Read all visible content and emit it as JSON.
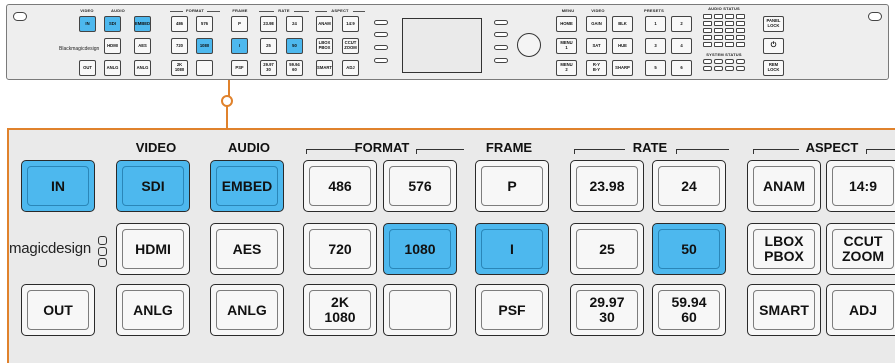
{
  "colors": {
    "accent_orange": "#e0822c",
    "active_blue": "#4db8ee",
    "panel_bg": "#eaeaea"
  },
  "overview": {
    "headers": {
      "video": "VIDEO",
      "audio": "AUDIO",
      "format": "FORMAT",
      "frame": "FRAME",
      "rate": "RATE",
      "aspect": "ASPECT",
      "menu": "MENU",
      "video2": "VIDEO",
      "presets": "PRESETS",
      "audio_status": "AUDIO STATUS",
      "system_status": "SYSTEM STATUS"
    },
    "logo": "Blackmagicdesign",
    "keys": {
      "in": "IN",
      "sdi": "SDI",
      "embed": "EMBED",
      "hdmi": "HDMI",
      "aes": "AES",
      "out": "OUT",
      "anlg_v": "ANLG",
      "anlg_a": "ANLG",
      "f486": "486",
      "f576": "576",
      "f720": "720",
      "f1080": "1080",
      "f2k": "2K\n1080",
      "fblank": "",
      "p": "P",
      "i": "I",
      "psf": "PSF",
      "r2398": "23.98",
      "r24": "24",
      "r25": "25",
      "r50": "50",
      "r2997": "29.97\n30",
      "r5994": "59.94\n60",
      "anam": "ANAM",
      "a149": "14:9",
      "lbox": "LBOX\nPBOX",
      "ccut": "CCUT\nZOOM",
      "smart": "SMART",
      "adj": "ADJ",
      "home": "HOME",
      "menu1": "MENU\n1",
      "menu2": "MENU\n2",
      "gain": "GAIN",
      "blk": "BLK",
      "sat": "SAT",
      "hue": "HUE",
      "ry": "R-Y\nB-Y",
      "sharp": "SHARP",
      "p1": "1",
      "p2": "2",
      "p3": "3",
      "p4": "4",
      "p5": "5",
      "p6": "6",
      "panel_lock": "PANEL\nLOCK",
      "power": "⏻",
      "rem_lock": "REM\nLOCK"
    }
  },
  "zoom": {
    "headers": {
      "video": "VIDEO",
      "audio": "AUDIO",
      "format": "FORMAT",
      "frame": "FRAME",
      "rate": "RATE",
      "aspect": "ASPECT"
    },
    "logo": "magicdesign",
    "buttons": {
      "in": "IN",
      "sdi": "SDI",
      "embed": "EMBED",
      "f486": "486",
      "f576": "576",
      "p": "P",
      "r2398": "23.98",
      "r24": "24",
      "anam": "ANAM",
      "a149": "14:9",
      "hdmi": "HDMI",
      "aes": "AES",
      "f720": "720",
      "f1080": "1080",
      "i": "I",
      "r25": "25",
      "r50": "50",
      "lbox": "LBOX\nPBOX",
      "ccut": "CCUT\nZOOM",
      "out": "OUT",
      "anlg_v": "ANLG",
      "anlg_a": "ANLG",
      "f2k": "2K\n1080",
      "fblank": "",
      "psf": "PSF",
      "r2997": "29.97\n30",
      "r5994": "59.94\n60",
      "smart": "SMART",
      "adj": "ADJ"
    }
  }
}
